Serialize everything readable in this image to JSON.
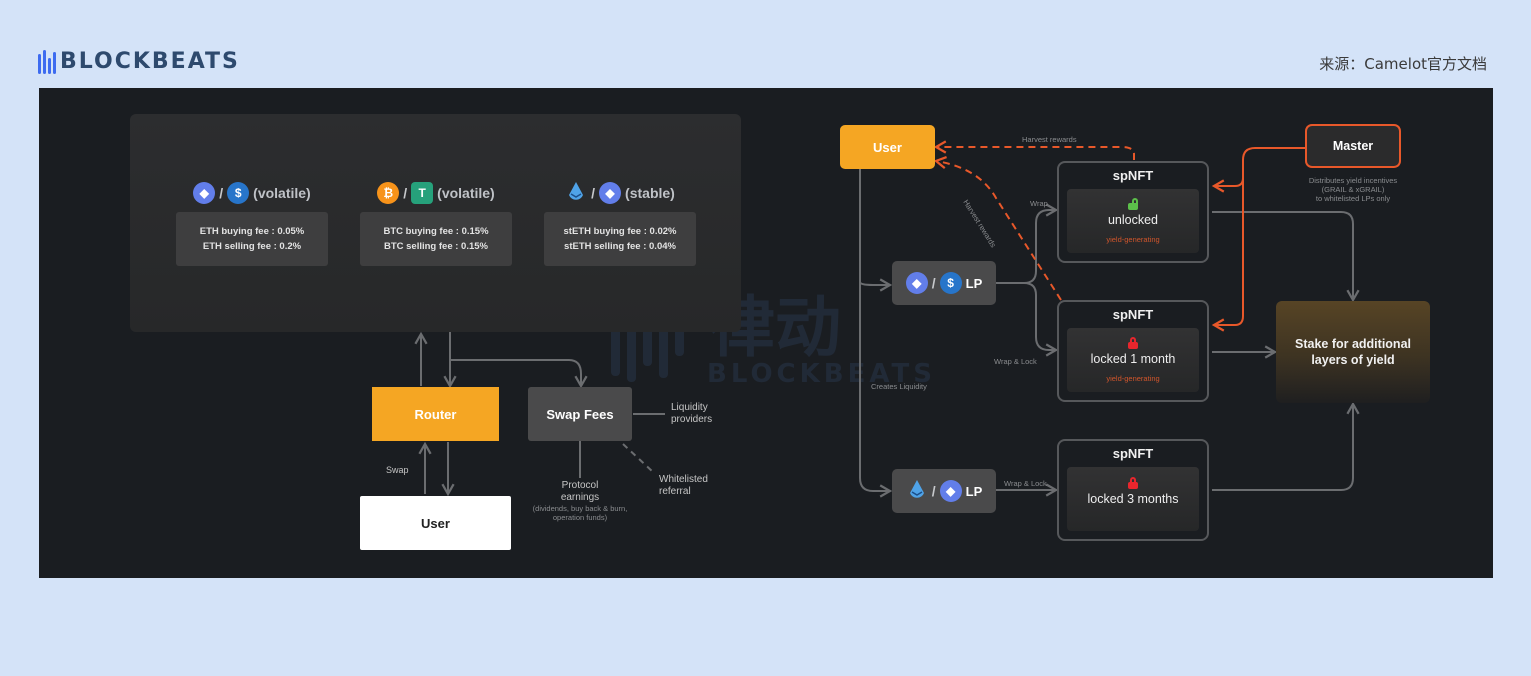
{
  "header": {
    "logo_text": "BLOCKBEATS",
    "source": "来源：Camelot官方文档"
  },
  "colors": {
    "page_bg": "#d4e3f8",
    "canvas_bg": "#1a1d21",
    "accent_orange": "#f5a623",
    "harvest_orange": "#e8582a",
    "node_gray": "#4a4a4b",
    "yield_text": "#d0552c"
  },
  "pools": [
    {
      "token_a": {
        "icon": "eth-icon",
        "symbol": "ETH"
      },
      "token_b": {
        "icon": "usdc-icon",
        "symbol": "USDC"
      },
      "type": "(volatile)",
      "buying_fee": "ETH buying fee : 0.05%",
      "selling_fee": "ETH selling fee : 0.2%"
    },
    {
      "token_a": {
        "icon": "btc-icon",
        "symbol": "BTC"
      },
      "token_b": {
        "icon": "usdt-icon",
        "symbol": "USDT"
      },
      "type": "(volatile)",
      "buying_fee": "BTC buying fee : 0.15%",
      "selling_fee": "BTC selling fee : 0.15%"
    },
    {
      "token_a": {
        "icon": "steth-icon",
        "symbol": "stETH"
      },
      "token_b": {
        "icon": "eth-icon",
        "symbol": "ETH"
      },
      "type": "(stable)",
      "buying_fee": "stETH buying fee : 0.02%",
      "selling_fee": "stETH selling fee : 0.04%"
    }
  ],
  "swap_flow": {
    "router": "Router",
    "swap_fees": "Swap Fees",
    "user": "User",
    "swap_label": "Swap",
    "liquidity_providers": "Liquidity providers",
    "whitelisted_referral": "Whitelisted referral",
    "protocol_earnings": "Protocol earnings",
    "protocol_earnings_detail": "(dividends, buy back & burn, operation funds)"
  },
  "liquidity_flow": {
    "user": "User",
    "master": "Master",
    "master_desc": [
      "Distributes yield incentives",
      "(GRAIL & xGRAIL)",
      "to whitelisted LPs only"
    ],
    "harvest_rewards_top": "Harvest rewards",
    "harvest_rewards_diag": "Harvest rewards",
    "creates_liquidity": "Creates Liquidity",
    "lp_label": "LP",
    "wrap": "Wrap",
    "wrap_lock_1": "Wrap & Lock",
    "wrap_lock_2": "Wrap & Lock",
    "spnft": [
      {
        "title": "spNFT",
        "state": "unlocked",
        "locked": false,
        "yield": "yield-generating"
      },
      {
        "title": "spNFT",
        "state": "locked 1 month",
        "locked": true,
        "yield": "yield-generating"
      },
      {
        "title": "spNFT",
        "state": "locked 3 months",
        "locked": true,
        "yield": ""
      }
    ],
    "stake": "Stake for additional layers of yield"
  },
  "watermark": {
    "cn": "律动",
    "en": "BLOCKBEATS"
  }
}
